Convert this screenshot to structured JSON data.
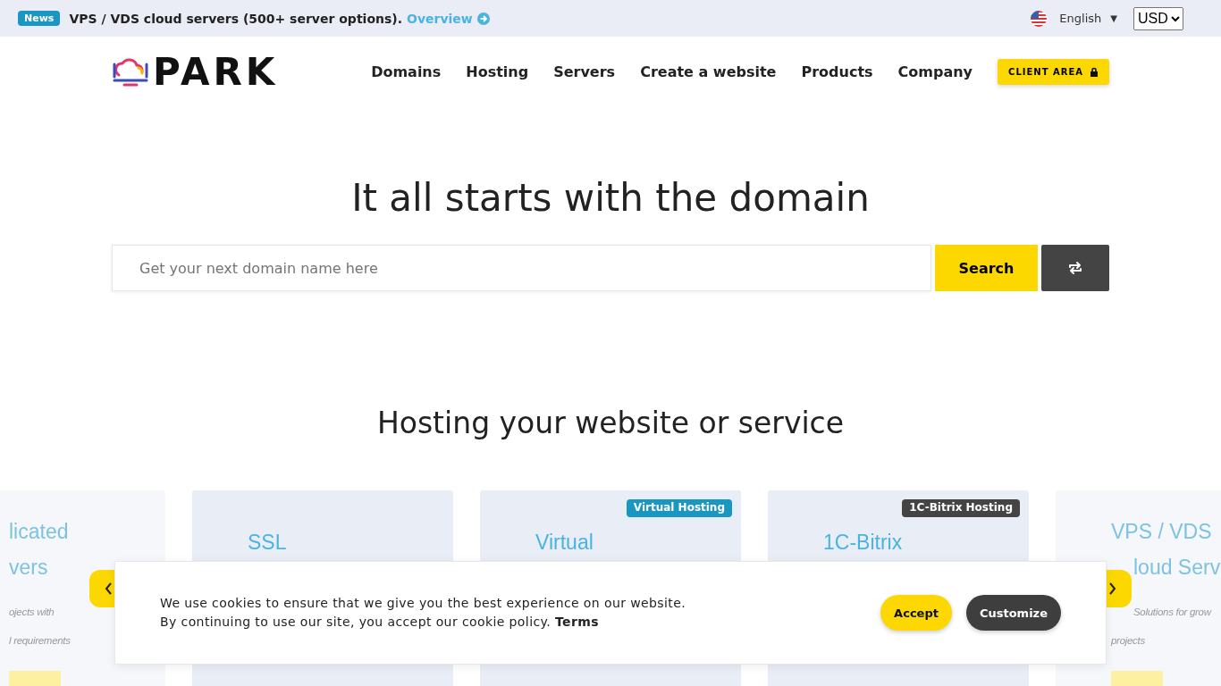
{
  "news_bar": {
    "badge": "News",
    "text": "VPS / VDS cloud servers (500+ server options).",
    "link": "Overview",
    "language": "English",
    "language_caret": "▼",
    "currency": "USD"
  },
  "header": {
    "logo": "PARK",
    "nav": [
      "Domains",
      "Hosting",
      "Servers",
      "Create a website",
      "Products",
      "Company"
    ],
    "client_button": "CLIENT AREA"
  },
  "hero": {
    "title": "It all starts with the domain",
    "search": {
      "placeholder": "Get your next domain name here",
      "button": "Search"
    }
  },
  "hosting": {
    "title": "Hosting your website or service",
    "cards": [
      {
        "active": false,
        "title_lines": [
          "licated",
          "vers"
        ],
        "desc_lines": [
          "ojects with",
          "l requirements"
        ]
      },
      {
        "active": true,
        "title_lines": [
          "SSL"
        ]
      },
      {
        "active": true,
        "tag": "Virtual Hosting",
        "color": "#1a96c3",
        "title_lines": [
          "Virtual"
        ]
      },
      {
        "active": true,
        "tag": "1C-Bitrix Hosting",
        "color": "#444444",
        "title_lines": [
          "1C-Bitrix"
        ]
      },
      {
        "active": false,
        "title_lines": [
          "VPS / VDS",
          "loud Serv"
        ],
        "desc_lines": [
          "Solutions for grow",
          "projects"
        ]
      }
    ]
  },
  "cookie_banner": {
    "lines": [
      "We use cookies to ensure that we give you the best experience on our website.",
      "By continuing to use our site, you accept our cookie policy. **Terms**"
    ],
    "accept": "Accept",
    "customize": "Customize"
  }
}
